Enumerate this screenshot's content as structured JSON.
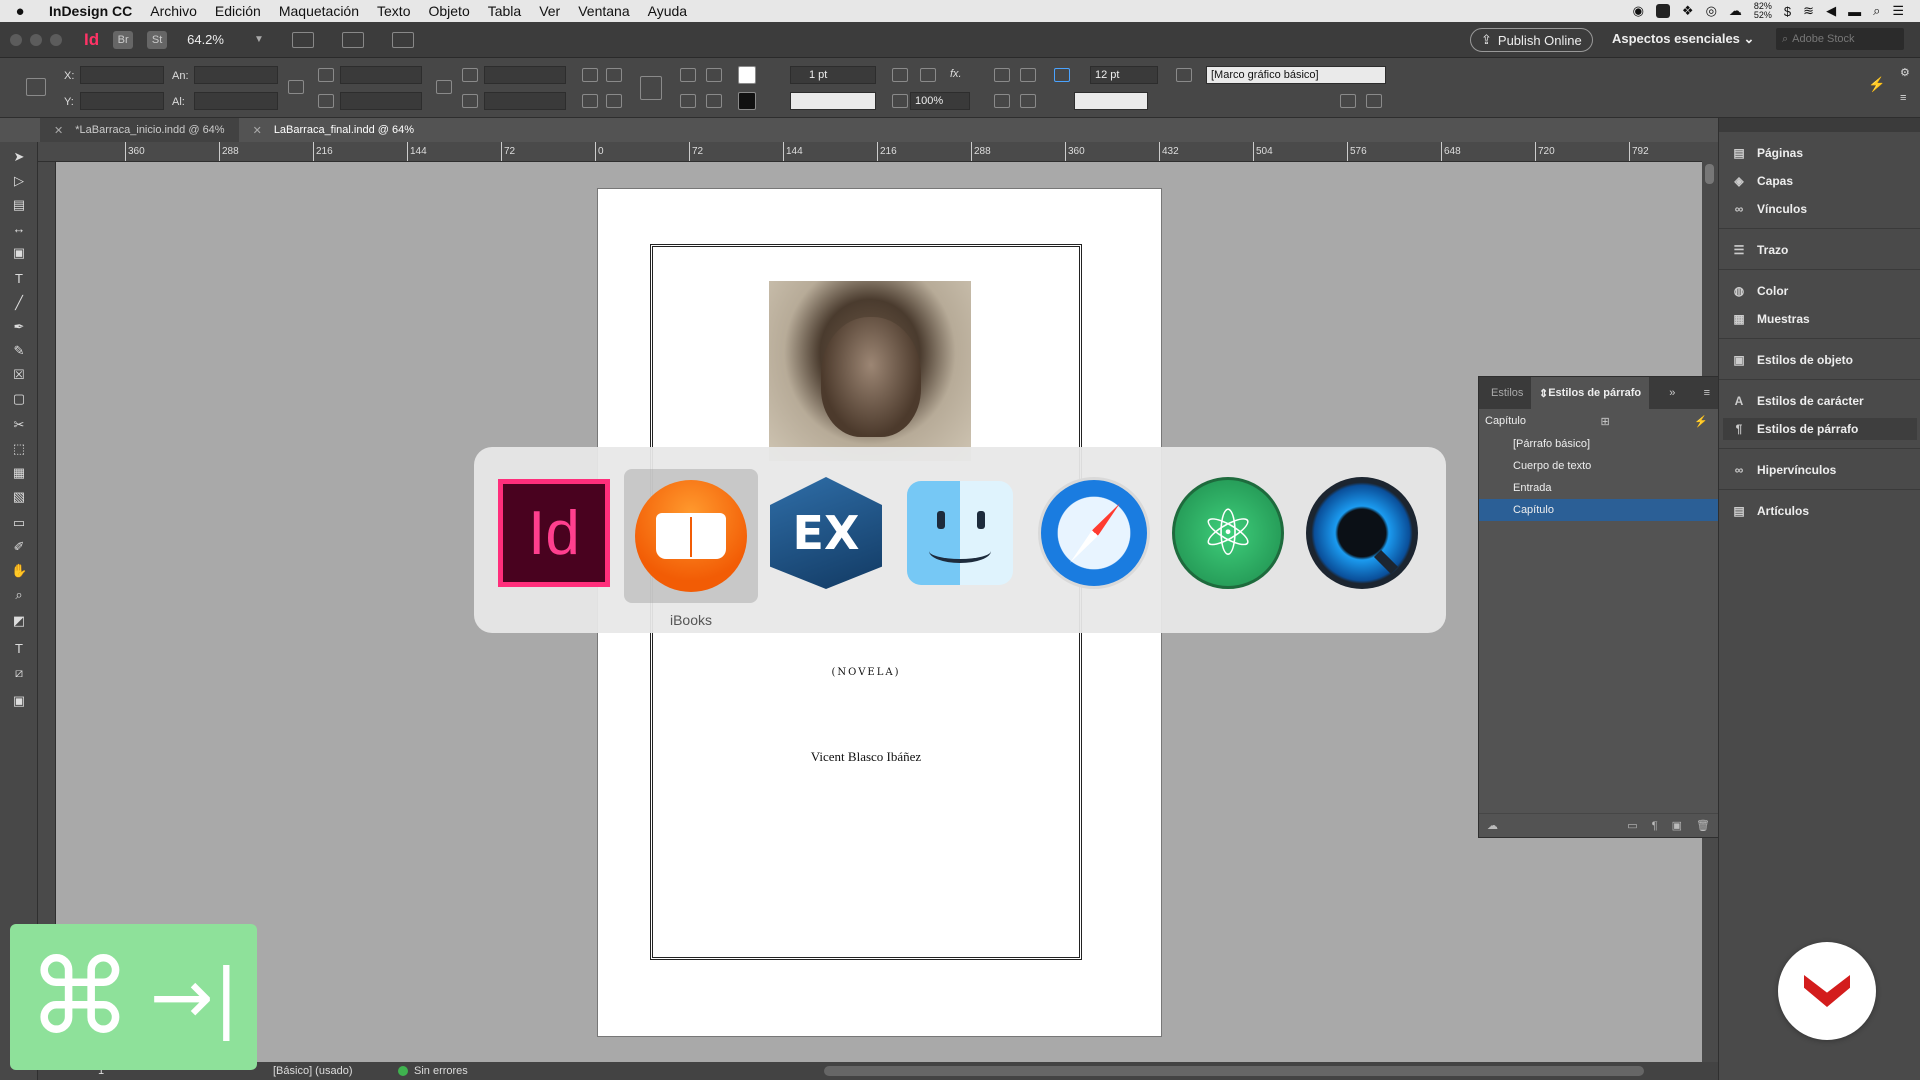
{
  "menubar": {
    "apple": "",
    "app_name": "InDesign CC",
    "items": [
      "Archivo",
      "Edición",
      "Maquetación",
      "Texto",
      "Objeto",
      "Tabla",
      "Ver",
      "Ventana",
      "Ayuda"
    ],
    "battery_top": "82%",
    "battery_bottom": "52%"
  },
  "appbar": {
    "app_icon": "Id",
    "bridge": "Br",
    "stock": "St",
    "zoom": "64.2%",
    "publish_label": "Publish Online",
    "workspace": "Aspectos esenciales",
    "search_placeholder": "Adobe Stock"
  },
  "control": {
    "x_label": "X:",
    "y_label": "Y:",
    "w_label": "An:",
    "h_label": "Al:",
    "stroke_weight": "1 pt",
    "scale": "100%",
    "gap": "12 pt",
    "object_style": "[Marco gráfico básico]"
  },
  "doc_tabs": [
    {
      "label": "*LaBarraca_inicio.indd @ 64%"
    },
    {
      "label": "LaBarraca_final.indd @ 64%"
    }
  ],
  "ruler": {
    "ticks": [
      "360",
      "288",
      "216",
      "144",
      "72",
      "0",
      "72",
      "144",
      "216",
      "288",
      "360",
      "432",
      "504",
      "576",
      "648",
      "720",
      "792"
    ]
  },
  "page": {
    "subtitle": "(NOVELA)",
    "author": "Vicent Blasco Ibáñez"
  },
  "switcher": {
    "selected_label": "iBooks",
    "apps": [
      "indesign-icon",
      "ibooks-icon",
      "exf-icon",
      "finder-icon",
      "safari-icon",
      "atom-icon",
      "quicktime-icon"
    ]
  },
  "dock": {
    "items": [
      "Páginas",
      "Capas",
      "Vínculos",
      "Trazo",
      "Color",
      "Muestras",
      "Estilos de objeto",
      "Estilos de carácter",
      "Estilos de párrafo",
      "Hipervínculos",
      "Artículos"
    ]
  },
  "pstyles": {
    "tab_inactive": "Estilos",
    "tab_active": "Estilos de párrafo",
    "current": "Capítulo",
    "rows": [
      "[Párrafo básico]",
      "Cuerpo de texto",
      "Entrada",
      "Capítulo"
    ],
    "selected_index": 3
  },
  "status": {
    "page_num": "1",
    "style": "[Básico] (usado)",
    "errors": "Sin errores"
  },
  "overlay": {
    "cmd_symbol": "⌘",
    "tab_symbol": "→|"
  },
  "colors": {
    "selected_row": "#2b5f96",
    "overlay_green": "#8ee19a",
    "badge_red": "#d31c1c"
  }
}
